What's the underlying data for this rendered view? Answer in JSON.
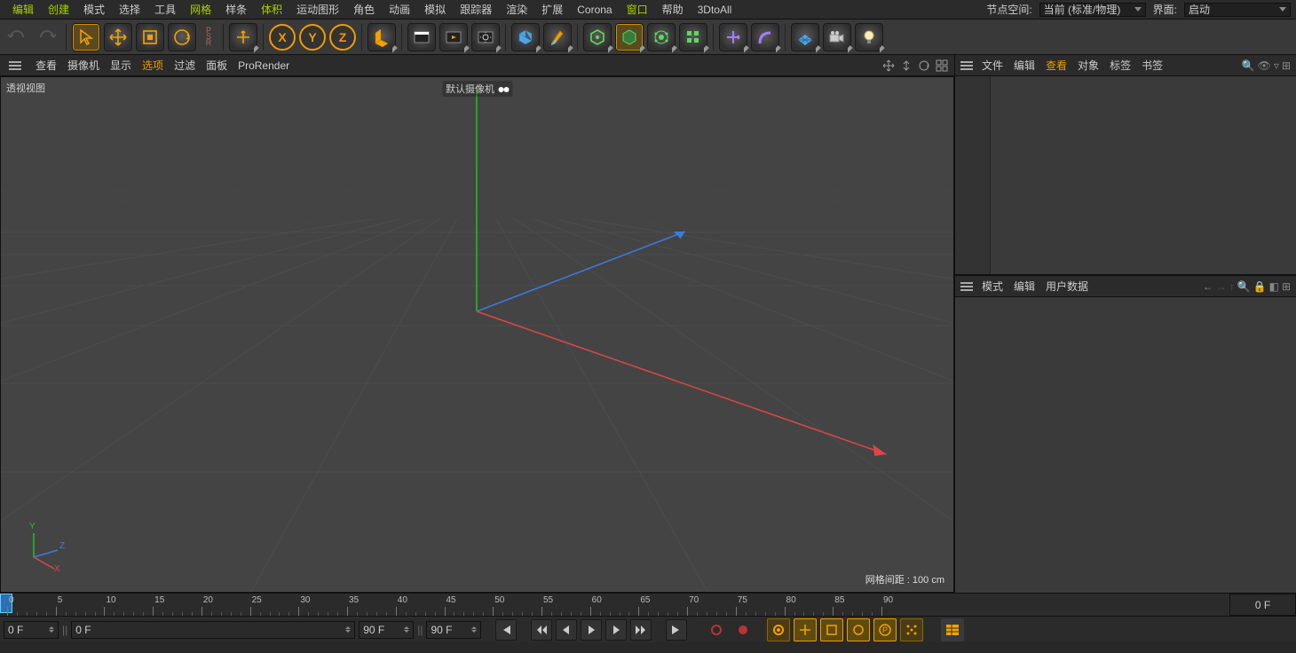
{
  "menu": {
    "items": [
      {
        "label": "编辑",
        "hl": true
      },
      {
        "label": "创建",
        "hl": true
      },
      {
        "label": "模式"
      },
      {
        "label": "选择"
      },
      {
        "label": "工具"
      },
      {
        "label": "网格",
        "hl": true
      },
      {
        "label": "样条"
      },
      {
        "label": "体积",
        "hl": true
      },
      {
        "label": "运动图形"
      },
      {
        "label": "角色"
      },
      {
        "label": "动画"
      },
      {
        "label": "模拟"
      },
      {
        "label": "跟踪器"
      },
      {
        "label": "渲染"
      },
      {
        "label": "扩展"
      },
      {
        "label": "Corona"
      },
      {
        "label": "窗口",
        "hl": true
      },
      {
        "label": "帮助"
      },
      {
        "label": "3DtoAll"
      }
    ],
    "node_space_label": "节点空间:",
    "node_space_value": "当前 (标准/物理)",
    "interface_label": "界面:",
    "interface_value": "启动"
  },
  "axes": {
    "x": "X",
    "y": "Y",
    "z": "Z"
  },
  "viewport_menu": {
    "items": [
      "查看",
      "摄像机",
      "显示",
      "选项",
      "过滤",
      "面板",
      "ProRender"
    ],
    "selected_idx": 3
  },
  "viewport": {
    "title": "透视视图",
    "camera": "默认摄像机",
    "grid_label": "网格间距 : 100 cm"
  },
  "mini_axis": {
    "x": "X",
    "y": "Y",
    "z": "Z"
  },
  "obj_panel": {
    "tabs": [
      "文件",
      "编辑",
      "查看",
      "对象",
      "标签",
      "书签"
    ],
    "selected_idx": 2
  },
  "attr_panel": {
    "tabs": [
      "模式",
      "编辑",
      "用户数据"
    ]
  },
  "timeline": {
    "start": 0,
    "end": 90,
    "step": 5,
    "end_field": "0 F"
  },
  "controls": {
    "f1": "0 F",
    "f2": "0 F",
    "f3": "90 F",
    "f4": "90 F"
  }
}
